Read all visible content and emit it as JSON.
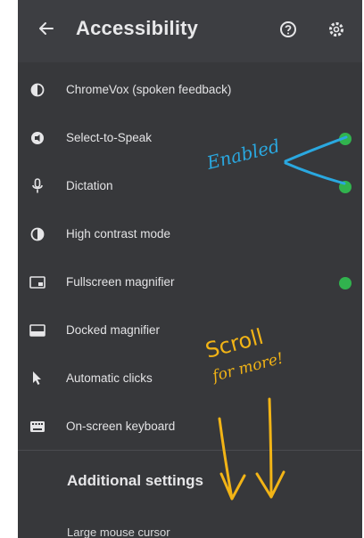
{
  "header": {
    "title": "Accessibility",
    "back_icon": "arrow-back-icon",
    "help_icon": "help-icon",
    "settings_icon": "gear-icon"
  },
  "settings": [
    {
      "label": "ChromeVox (spoken feedback)",
      "icon": "chromevox-icon",
      "enabled": false
    },
    {
      "label": "Select-to-Speak",
      "icon": "select-to-speak-icon",
      "enabled": true
    },
    {
      "label": "Dictation",
      "icon": "microphone-icon",
      "enabled": true
    },
    {
      "label": "High contrast mode",
      "icon": "contrast-icon",
      "enabled": false
    },
    {
      "label": "Fullscreen magnifier",
      "icon": "fullscreen-magnifier-icon",
      "enabled": true
    },
    {
      "label": "Docked magnifier",
      "icon": "docked-magnifier-icon",
      "enabled": false
    },
    {
      "label": "Automatic clicks",
      "icon": "cursor-click-icon",
      "enabled": false
    },
    {
      "label": "On-screen keyboard",
      "icon": "keyboard-icon",
      "enabled": false
    }
  ],
  "additional": {
    "title": "Additional settings",
    "first_item": "Large mouse cursor"
  },
  "annotations": {
    "enabled_note": "Enabled",
    "scroll_note_line1": "Scroll",
    "scroll_note_line2": "for more!",
    "blue_color": "#2aa8e0",
    "yellow_color": "#f2b416"
  },
  "colors": {
    "panel_bg": "#37383b",
    "header_bg": "#3d3e42",
    "toggle_on": "#31b34e",
    "text": "#e3e3e5"
  }
}
